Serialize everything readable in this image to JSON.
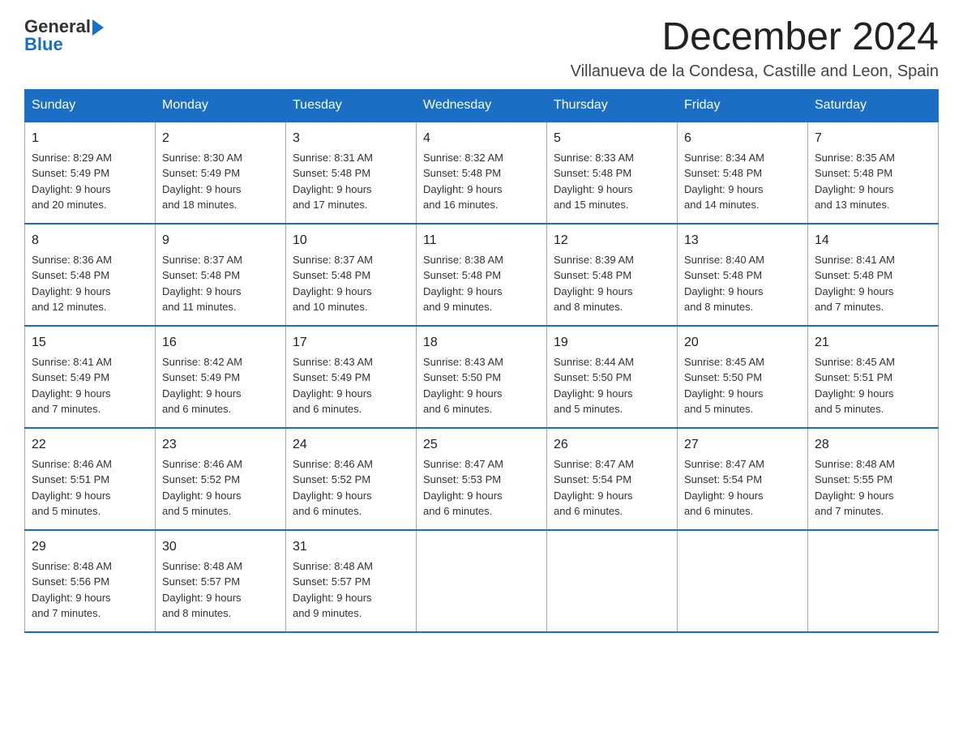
{
  "logo": {
    "general": "General",
    "blue": "Blue"
  },
  "header": {
    "month": "December 2024",
    "location": "Villanueva de la Condesa, Castille and Leon, Spain"
  },
  "days_of_week": [
    "Sunday",
    "Monday",
    "Tuesday",
    "Wednesday",
    "Thursday",
    "Friday",
    "Saturday"
  ],
  "weeks": [
    [
      {
        "num": "1",
        "sunrise": "8:29 AM",
        "sunset": "5:49 PM",
        "daylight": "9 hours and 20 minutes."
      },
      {
        "num": "2",
        "sunrise": "8:30 AM",
        "sunset": "5:49 PM",
        "daylight": "9 hours and 18 minutes."
      },
      {
        "num": "3",
        "sunrise": "8:31 AM",
        "sunset": "5:48 PM",
        "daylight": "9 hours and 17 minutes."
      },
      {
        "num": "4",
        "sunrise": "8:32 AM",
        "sunset": "5:48 PM",
        "daylight": "9 hours and 16 minutes."
      },
      {
        "num": "5",
        "sunrise": "8:33 AM",
        "sunset": "5:48 PM",
        "daylight": "9 hours and 15 minutes."
      },
      {
        "num": "6",
        "sunrise": "8:34 AM",
        "sunset": "5:48 PM",
        "daylight": "9 hours and 14 minutes."
      },
      {
        "num": "7",
        "sunrise": "8:35 AM",
        "sunset": "5:48 PM",
        "daylight": "9 hours and 13 minutes."
      }
    ],
    [
      {
        "num": "8",
        "sunrise": "8:36 AM",
        "sunset": "5:48 PM",
        "daylight": "9 hours and 12 minutes."
      },
      {
        "num": "9",
        "sunrise": "8:37 AM",
        "sunset": "5:48 PM",
        "daylight": "9 hours and 11 minutes."
      },
      {
        "num": "10",
        "sunrise": "8:37 AM",
        "sunset": "5:48 PM",
        "daylight": "9 hours and 10 minutes."
      },
      {
        "num": "11",
        "sunrise": "8:38 AM",
        "sunset": "5:48 PM",
        "daylight": "9 hours and 9 minutes."
      },
      {
        "num": "12",
        "sunrise": "8:39 AM",
        "sunset": "5:48 PM",
        "daylight": "9 hours and 8 minutes."
      },
      {
        "num": "13",
        "sunrise": "8:40 AM",
        "sunset": "5:48 PM",
        "daylight": "9 hours and 8 minutes."
      },
      {
        "num": "14",
        "sunrise": "8:41 AM",
        "sunset": "5:48 PM",
        "daylight": "9 hours and 7 minutes."
      }
    ],
    [
      {
        "num": "15",
        "sunrise": "8:41 AM",
        "sunset": "5:49 PM",
        "daylight": "9 hours and 7 minutes."
      },
      {
        "num": "16",
        "sunrise": "8:42 AM",
        "sunset": "5:49 PM",
        "daylight": "9 hours and 6 minutes."
      },
      {
        "num": "17",
        "sunrise": "8:43 AM",
        "sunset": "5:49 PM",
        "daylight": "9 hours and 6 minutes."
      },
      {
        "num": "18",
        "sunrise": "8:43 AM",
        "sunset": "5:50 PM",
        "daylight": "9 hours and 6 minutes."
      },
      {
        "num": "19",
        "sunrise": "8:44 AM",
        "sunset": "5:50 PM",
        "daylight": "9 hours and 5 minutes."
      },
      {
        "num": "20",
        "sunrise": "8:45 AM",
        "sunset": "5:50 PM",
        "daylight": "9 hours and 5 minutes."
      },
      {
        "num": "21",
        "sunrise": "8:45 AM",
        "sunset": "5:51 PM",
        "daylight": "9 hours and 5 minutes."
      }
    ],
    [
      {
        "num": "22",
        "sunrise": "8:46 AM",
        "sunset": "5:51 PM",
        "daylight": "9 hours and 5 minutes."
      },
      {
        "num": "23",
        "sunrise": "8:46 AM",
        "sunset": "5:52 PM",
        "daylight": "9 hours and 5 minutes."
      },
      {
        "num": "24",
        "sunrise": "8:46 AM",
        "sunset": "5:52 PM",
        "daylight": "9 hours and 6 minutes."
      },
      {
        "num": "25",
        "sunrise": "8:47 AM",
        "sunset": "5:53 PM",
        "daylight": "9 hours and 6 minutes."
      },
      {
        "num": "26",
        "sunrise": "8:47 AM",
        "sunset": "5:54 PM",
        "daylight": "9 hours and 6 minutes."
      },
      {
        "num": "27",
        "sunrise": "8:47 AM",
        "sunset": "5:54 PM",
        "daylight": "9 hours and 6 minutes."
      },
      {
        "num": "28",
        "sunrise": "8:48 AM",
        "sunset": "5:55 PM",
        "daylight": "9 hours and 7 minutes."
      }
    ],
    [
      {
        "num": "29",
        "sunrise": "8:48 AM",
        "sunset": "5:56 PM",
        "daylight": "9 hours and 7 minutes."
      },
      {
        "num": "30",
        "sunrise": "8:48 AM",
        "sunset": "5:57 PM",
        "daylight": "9 hours and 8 minutes."
      },
      {
        "num": "31",
        "sunrise": "8:48 AM",
        "sunset": "5:57 PM",
        "daylight": "9 hours and 9 minutes."
      },
      null,
      null,
      null,
      null
    ]
  ],
  "labels": {
    "sunrise": "Sunrise:",
    "sunset": "Sunset:",
    "daylight": "Daylight:"
  }
}
